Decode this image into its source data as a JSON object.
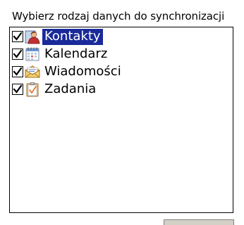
{
  "dialog": {
    "heading": "Wybierz rodzaj danych do synchronizacji"
  },
  "sync_list": {
    "items": [
      {
        "label": "Kontakty",
        "checked": true,
        "selected": true,
        "icon": "contacts-icon"
      },
      {
        "label": "Kalendarz",
        "checked": true,
        "selected": false,
        "icon": "calendar-icon"
      },
      {
        "label": "Wiadomości",
        "checked": true,
        "selected": false,
        "icon": "messages-icon"
      },
      {
        "label": "Zadania",
        "checked": true,
        "selected": false,
        "icon": "tasks-icon"
      }
    ]
  },
  "colors": {
    "selection_background": "#1a2a9a",
    "selection_text": "#ffffff"
  }
}
